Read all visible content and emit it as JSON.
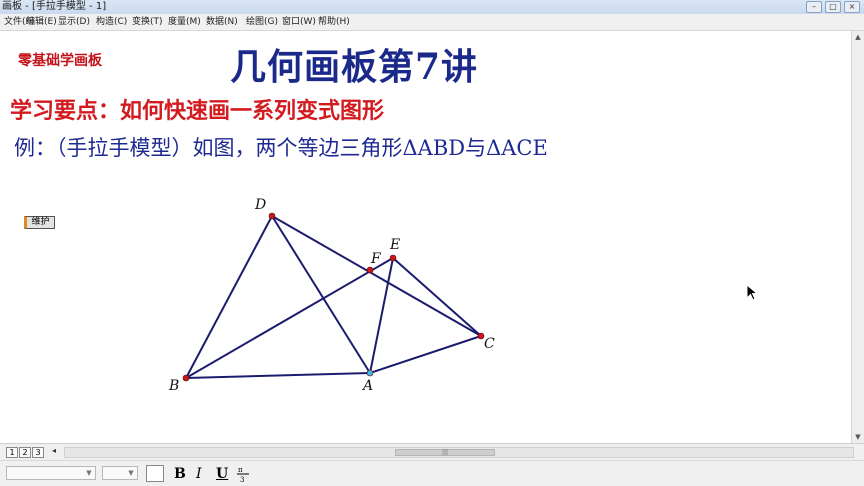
{
  "window": {
    "title": "画板 - [手拉手模型 - 1]",
    "controls": [
      "–",
      "□",
      "×"
    ]
  },
  "menu": [
    "文件(F)",
    "编辑(E)",
    "显示(D)",
    "构造(C)",
    "变换(T)",
    "度量(M)",
    "数据(N)",
    "绘图(G)",
    "窗口(W)",
    "帮助(H)"
  ],
  "headings": {
    "small": "零基础学画板",
    "main": "几何画板第7讲",
    "points": "学习要点：如何快速画一系列变式图形",
    "example": "例：（手拉手模型）如图，两个等边三角形ΔABD与ΔACE"
  },
  "buttons": {
    "maintain": "维护"
  },
  "figure": {
    "points": [
      {
        "label": "D"
      },
      {
        "label": "F"
      },
      {
        "label": "E"
      },
      {
        "label": "C"
      },
      {
        "label": "B"
      },
      {
        "label": "A"
      }
    ],
    "line_color": "#1c1c6e",
    "point_color": "#c8161d",
    "highlight_color": "#3fb6e6"
  },
  "page_tabs": [
    "1",
    "2",
    "3"
  ],
  "toolbar": {
    "bold": "B",
    "italic": "I",
    "underline": "U",
    "fraction_icon": "fraction-icon"
  }
}
